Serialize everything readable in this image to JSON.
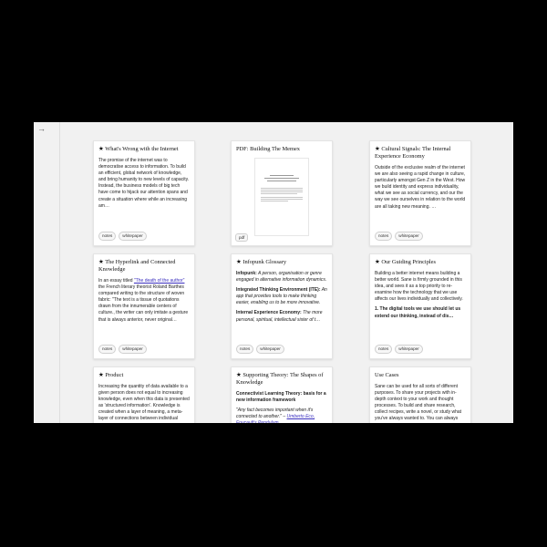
{
  "sidebar": {
    "collapse_icon": "→"
  },
  "cards": {
    "c1": {
      "star": "★",
      "title": "What's Wrong with the Internet",
      "body": "The promise of the internet was to democratise access to information. To build an efficient, global network of knowledge, and bring humanity to new levels of capacity. Instead, the business models of big tech have come to hijack our attention spans and create a situation where while an increasing am…",
      "tags": [
        "notes",
        "whitepaper"
      ]
    },
    "c2": {
      "title": "PDF: Building The Memex",
      "badge": "pdf"
    },
    "c3": {
      "star": "★",
      "title": "Cultural Signals: The Internal Experience Economy",
      "body": "Outside of the exclusive realm of the internet we are also seeing a rapid change in culture, particularly amongst Gen Z in the West. How we build identity and express individuality, what we see as social currency, and our the way we see ourselves in relation to the world are all taking new meaning. …",
      "tags": [
        "notes",
        "whitepaper"
      ]
    },
    "c4": {
      "star": "★",
      "title": "The Hyperlink and Connected Knowledge",
      "body_pre": "In an essay titled ",
      "body_link": "\"The death of the author\"",
      "body_post": " the French literary theorist Roland Barthes compared writing to the structure of woven fabric: \"The text is a tissue of quotations drawn from the innumerable centers of culture., the writer can only imitate a gesture that is always anterior, never original…",
      "tags": [
        "notes",
        "whitepaper"
      ]
    },
    "c5": {
      "star": "★",
      "title": "Infopunk Glossary",
      "t1": "Infopunk:",
      "d1": " A person, organisation or genre engaged in alternative information dynamics.",
      "t2": "Integrated Thinking Environment (ITE):",
      "d2": " An app that provides tools to make thinking easier, enabling us to be more innovative.",
      "t3": "Internal Experience Economy:",
      "d3": " The more personal, spiritual, intellectual sister of t…",
      "tags": [
        "notes",
        "whitepaper"
      ]
    },
    "c6": {
      "star": "★",
      "title": "Our Guiding Principles",
      "body": "Building a better internet means building a better world. Sane is firmly grounded in this idea, and sees it as a top priority to re-examine how the technology that we use affects our lives individually and collectively.",
      "bold": "1. The digital tools we use should let us extend our thinking, instead of dis…",
      "tags": [
        "notes",
        "whitepaper"
      ]
    },
    "c7": {
      "star": "★",
      "title": "Product",
      "body": "Increasing the quantity of data available to a given person does not equal to increasing knowledge, even when this data is presented as 'structured information'. Knowledge is created when a layer of meaning, a meta-layer of connections between individual points, is added to it."
    },
    "c8": {
      "star": "★",
      "title": "Supporting Theory: The Shapes of Knowledge",
      "bold": "Connectivist Learning Theory: basis for a new information framework",
      "quote": "\"Any fact becomes important when it's connected to another.\" – ",
      "quote_link": "Umberto Eco, Foucault's Pendulum"
    },
    "c9": {
      "title": "Use Cases",
      "body": "Sane can be used for all sorts of different purposes. To share your projects with in-depth context to your work and thought processes. To build and share research, collect recipes, write a novel, or study what you've always wanted to. You can always choose to publish, collaborate, or keep the space…"
    }
  }
}
